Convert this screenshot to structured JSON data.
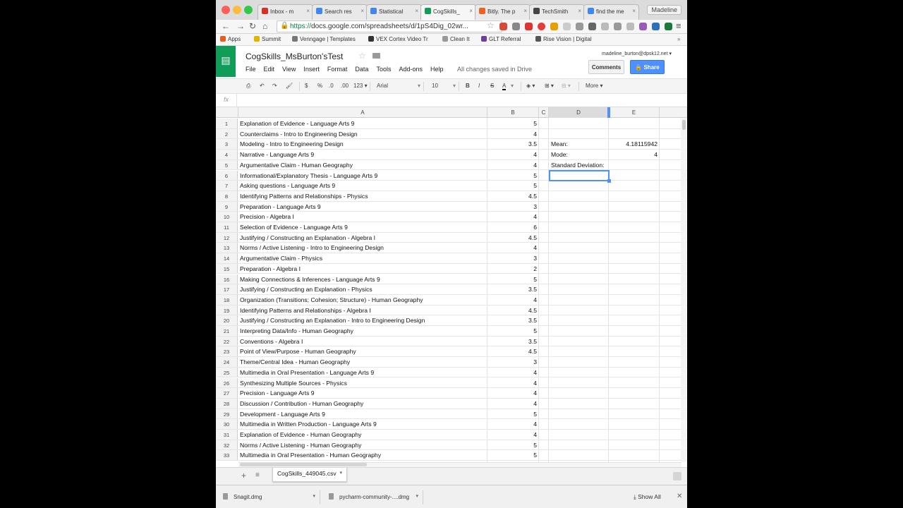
{
  "browser": {
    "tabs": [
      {
        "label": "Inbox - m",
        "color": "#d93025"
      },
      {
        "label": "Search res",
        "color": "#4285f4"
      },
      {
        "label": "Statistical",
        "color": "#4285f4"
      },
      {
        "label": "CogSkills_",
        "color": "#0f9d58"
      },
      {
        "label": "Bitly. The p",
        "color": "#ee6123"
      },
      {
        "label": "TechSmith",
        "color": "#444444"
      },
      {
        "label": "find the me",
        "color": "#4285f4"
      }
    ],
    "profile_name": "Madeline",
    "url_scheme": "https://",
    "url_rest": "docs.google.com/spreadsheets/d/1pS4Dig_02wr...",
    "bookmarks": [
      "Apps",
      "Summit",
      "Venngage | Templates",
      "VEX Cortex Video Tr",
      "Clean It",
      "GLT Referral",
      "Rise Vision | Digital"
    ]
  },
  "doc": {
    "title": "CogSkills_MsBurton'sTest",
    "menu": [
      "File",
      "Edit",
      "View",
      "Insert",
      "Format",
      "Data",
      "Tools",
      "Add-ons",
      "Help"
    ],
    "save_status": "All changes saved in Drive",
    "user_email": "madeline_burton@dpsk12.net",
    "comments_label": "Comments",
    "share_label": "Share"
  },
  "toolbar": {
    "currency": "$",
    "percent": "%",
    "dec_less": ".0",
    "dec_more": ".00",
    "number_format": "123",
    "font": "Arial",
    "font_size": "10",
    "bold": "B",
    "italic": "I",
    "strike": "S",
    "text_color": "A",
    "more": "More"
  },
  "formula_bar": {
    "fx": "fx"
  },
  "columns": [
    "A",
    "B",
    "C",
    "D",
    "E"
  ],
  "rows": [
    {
      "n": "1",
      "a": "Explanation of Evidence - Language Arts 9",
      "b": "5",
      "d": "",
      "e": ""
    },
    {
      "n": "2",
      "a": "Counterclaims - Intro to Engineering Design",
      "b": "4",
      "d": "",
      "e": ""
    },
    {
      "n": "3",
      "a": "Modeling - Intro to Engineering Design",
      "b": "3.5",
      "d": "Mean:",
      "e": "4.18115942"
    },
    {
      "n": "4",
      "a": "Narrative - Language Arts 9",
      "b": "4",
      "d": "Mode:",
      "e": "4"
    },
    {
      "n": "5",
      "a": "Argumentative Claim - Human Geography",
      "b": "4",
      "d": "Standard Deviation:",
      "e": ""
    },
    {
      "n": "6",
      "a": "Informational/Explanatory Thesis - Language Arts 9",
      "b": "5",
      "d": "",
      "e": ""
    },
    {
      "n": "7",
      "a": "Asking questions - Language Arts 9",
      "b": "5",
      "d": "",
      "e": ""
    },
    {
      "n": "8",
      "a": "Identifying Patterns and Relationships - Physics",
      "b": "4.5",
      "d": "",
      "e": ""
    },
    {
      "n": "9",
      "a": "Preparation - Language Arts 9",
      "b": "3",
      "d": "",
      "e": ""
    },
    {
      "n": "10",
      "a": "Precision - Algebra I",
      "b": "4",
      "d": "",
      "e": ""
    },
    {
      "n": "11",
      "a": "Selection of Evidence - Language Arts 9",
      "b": "6",
      "d": "",
      "e": ""
    },
    {
      "n": "12",
      "a": "Justifying / Constructing an Explanation - Algebra I",
      "b": "4.5",
      "d": "",
      "e": ""
    },
    {
      "n": "13",
      "a": "Norms / Active Listening - Intro to Engineering Design",
      "b": "4",
      "d": "",
      "e": ""
    },
    {
      "n": "14",
      "a": "Argumentative Claim - Physics",
      "b": "3",
      "d": "",
      "e": ""
    },
    {
      "n": "15",
      "a": "Preparation - Algebra I",
      "b": "2",
      "d": "",
      "e": ""
    },
    {
      "n": "16",
      "a": "Making Connections & Inferences - Language Arts 9",
      "b": "5",
      "d": "",
      "e": ""
    },
    {
      "n": "17",
      "a": "Justifying / Constructing an Explanation - Physics",
      "b": "3.5",
      "d": "",
      "e": ""
    },
    {
      "n": "18",
      "a": "Organization (Transitions; Cohesion; Structure) - Human Geography",
      "b": "4",
      "d": "",
      "e": ""
    },
    {
      "n": "19",
      "a": "Identifying Patterns and Relationships - Algebra I",
      "b": "4.5",
      "d": "",
      "e": ""
    },
    {
      "n": "20",
      "a": "Justifying / Constructing an Explanation - Intro to Engineering Design",
      "b": "3.5",
      "d": "",
      "e": ""
    },
    {
      "n": "21",
      "a": "Interpreting Data/Info - Human Geography",
      "b": "5",
      "d": "",
      "e": ""
    },
    {
      "n": "22",
      "a": "Conventions - Algebra I",
      "b": "3.5",
      "d": "",
      "e": ""
    },
    {
      "n": "23",
      "a": "Point of View/Purpose - Human Geography",
      "b": "4.5",
      "d": "",
      "e": ""
    },
    {
      "n": "24",
      "a": "Theme/Central Idea - Human Geography",
      "b": "3",
      "d": "",
      "e": ""
    },
    {
      "n": "25",
      "a": "Multimedia in Oral Presentation - Language Arts 9",
      "b": "4",
      "d": "",
      "e": ""
    },
    {
      "n": "26",
      "a": "Synthesizing Multiple Sources - Physics",
      "b": "4",
      "d": "",
      "e": ""
    },
    {
      "n": "27",
      "a": "Precision - Language Arts 9",
      "b": "4",
      "d": "",
      "e": ""
    },
    {
      "n": "28",
      "a": "Discussion / Contribution - Human Geography",
      "b": "4",
      "d": "",
      "e": ""
    },
    {
      "n": "29",
      "a": "Development - Language Arts 9",
      "b": "5",
      "d": "",
      "e": ""
    },
    {
      "n": "30",
      "a": "Multimedia in Written Production - Language Arts 9",
      "b": "4",
      "d": "",
      "e": ""
    },
    {
      "n": "31",
      "a": "Explanation of Evidence - Human Geography",
      "b": "4",
      "d": "",
      "e": ""
    },
    {
      "n": "32",
      "a": "Norms / Active Listening - Human Geography",
      "b": "5",
      "d": "",
      "e": ""
    },
    {
      "n": "33",
      "a": "Multimedia in Oral Presentation - Human Geography",
      "b": "5",
      "d": "",
      "e": ""
    }
  ],
  "sheet_tab": "CogSkills_449045.csv",
  "downloads": {
    "items": [
      "Snagit.dmg",
      "pycharm-community-....dmg"
    ],
    "show_all": "Show All"
  },
  "colors": {
    "sheets_green": "#0f9d58",
    "share_blue": "#4d90fe",
    "selection_blue": "#4d90fe"
  }
}
